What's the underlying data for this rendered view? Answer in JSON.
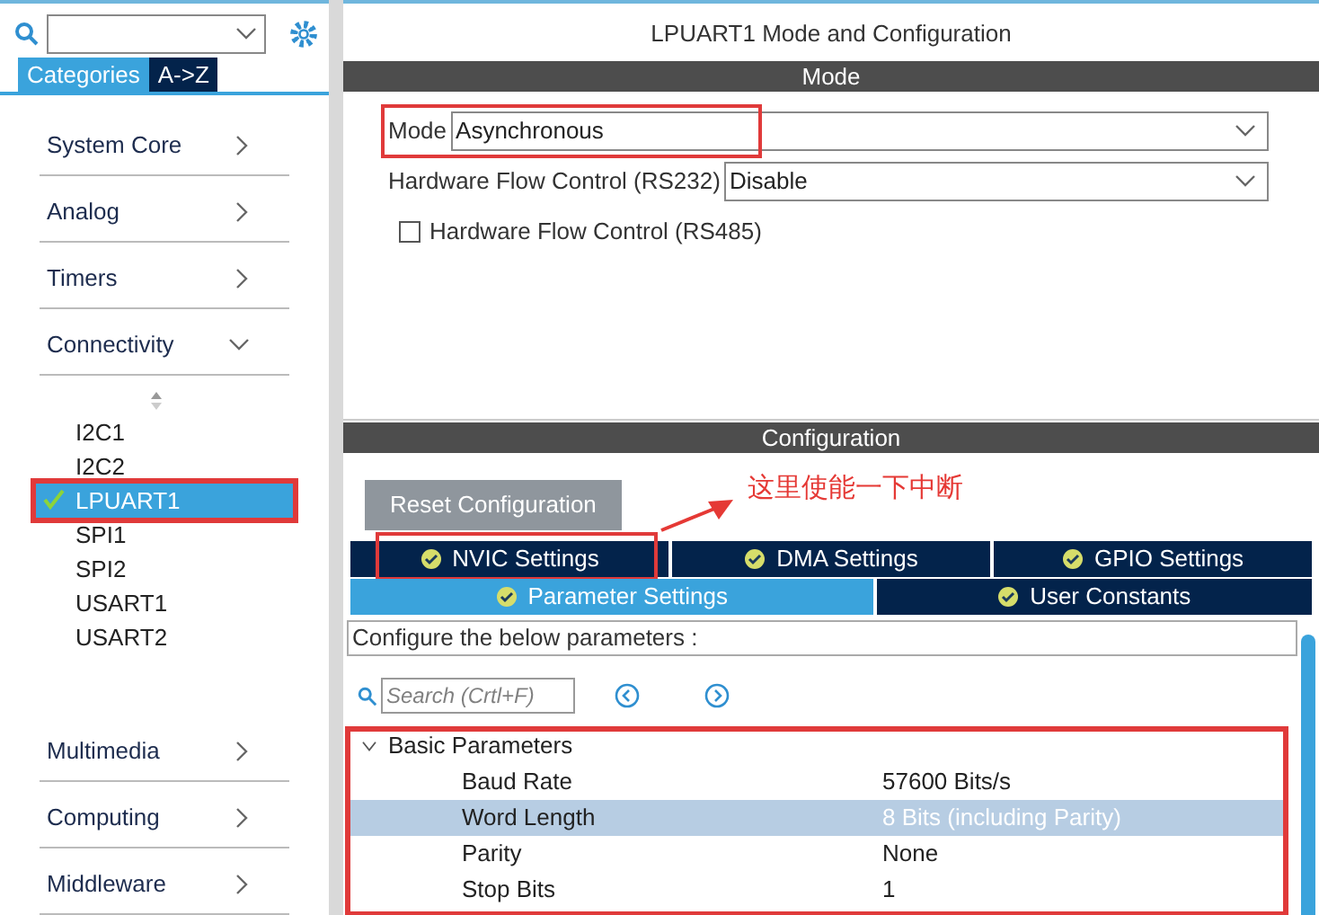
{
  "sidebar": {
    "tabs": [
      {
        "label": "Categories",
        "selected": true
      },
      {
        "label": "A->Z",
        "selected": false
      }
    ],
    "categories": [
      {
        "label": "System Core",
        "expanded": false
      },
      {
        "label": "Analog",
        "expanded": false
      },
      {
        "label": "Timers",
        "expanded": false
      },
      {
        "label": "Connectivity",
        "expanded": true,
        "items": [
          {
            "label": "I2C1",
            "selected": false,
            "configured": false,
            "highlighted": false
          },
          {
            "label": "I2C2",
            "selected": false,
            "configured": false,
            "highlighted": false
          },
          {
            "label": "LPUART1",
            "selected": true,
            "configured": true,
            "highlighted": true
          },
          {
            "label": "SPI1",
            "selected": false,
            "configured": false,
            "highlighted": false
          },
          {
            "label": "SPI2",
            "selected": false,
            "configured": false,
            "highlighted": false
          },
          {
            "label": "USART1",
            "selected": false,
            "configured": false,
            "highlighted": false
          },
          {
            "label": "USART2",
            "selected": false,
            "configured": false,
            "highlighted": false
          }
        ]
      },
      {
        "label": "Multimedia",
        "expanded": false
      },
      {
        "label": "Computing",
        "expanded": false
      },
      {
        "label": "Middleware",
        "expanded": false
      }
    ]
  },
  "panel": {
    "title": "LPUART1 Mode and Configuration",
    "mode_section": {
      "header": "Mode",
      "fields": [
        {
          "label": "Mode",
          "value": "Asynchronous",
          "highlighted": true
        },
        {
          "label": "Hardware Flow Control (RS232)",
          "value": "Disable",
          "highlighted": false
        }
      ],
      "checkbox": {
        "label": "Hardware Flow Control (RS485)",
        "checked": false
      }
    },
    "config_section": {
      "header": "Configuration",
      "reset_button": "Reset Configuration",
      "annotation": "这里使能一下中断",
      "tab_rows": [
        [
          {
            "label": "NVIC Settings",
            "selected": false,
            "highlighted": true
          },
          {
            "label": "DMA Settings",
            "selected": false,
            "highlighted": false
          },
          {
            "label": "GPIO Settings",
            "selected": false,
            "highlighted": false
          }
        ],
        [
          {
            "label": "Parameter Settings",
            "selected": true,
            "highlighted": false
          },
          {
            "label": "User Constants",
            "selected": false,
            "highlighted": false
          }
        ]
      ],
      "description": "Configure the below parameters :",
      "search": {
        "placeholder": "Search (Crtl+F)"
      },
      "groups": [
        {
          "label": "Basic Parameters",
          "expanded": true,
          "highlighted": true,
          "rows": [
            {
              "name": "Baud Rate",
              "value": "57600 Bits/s",
              "selected": false
            },
            {
              "name": "Word Length",
              "value": "8 Bits (including Parity)",
              "selected": true
            },
            {
              "name": "Parity",
              "value": "None",
              "selected": false
            },
            {
              "name": "Stop Bits",
              "value": "1",
              "selected": false
            }
          ]
        }
      ]
    }
  }
}
